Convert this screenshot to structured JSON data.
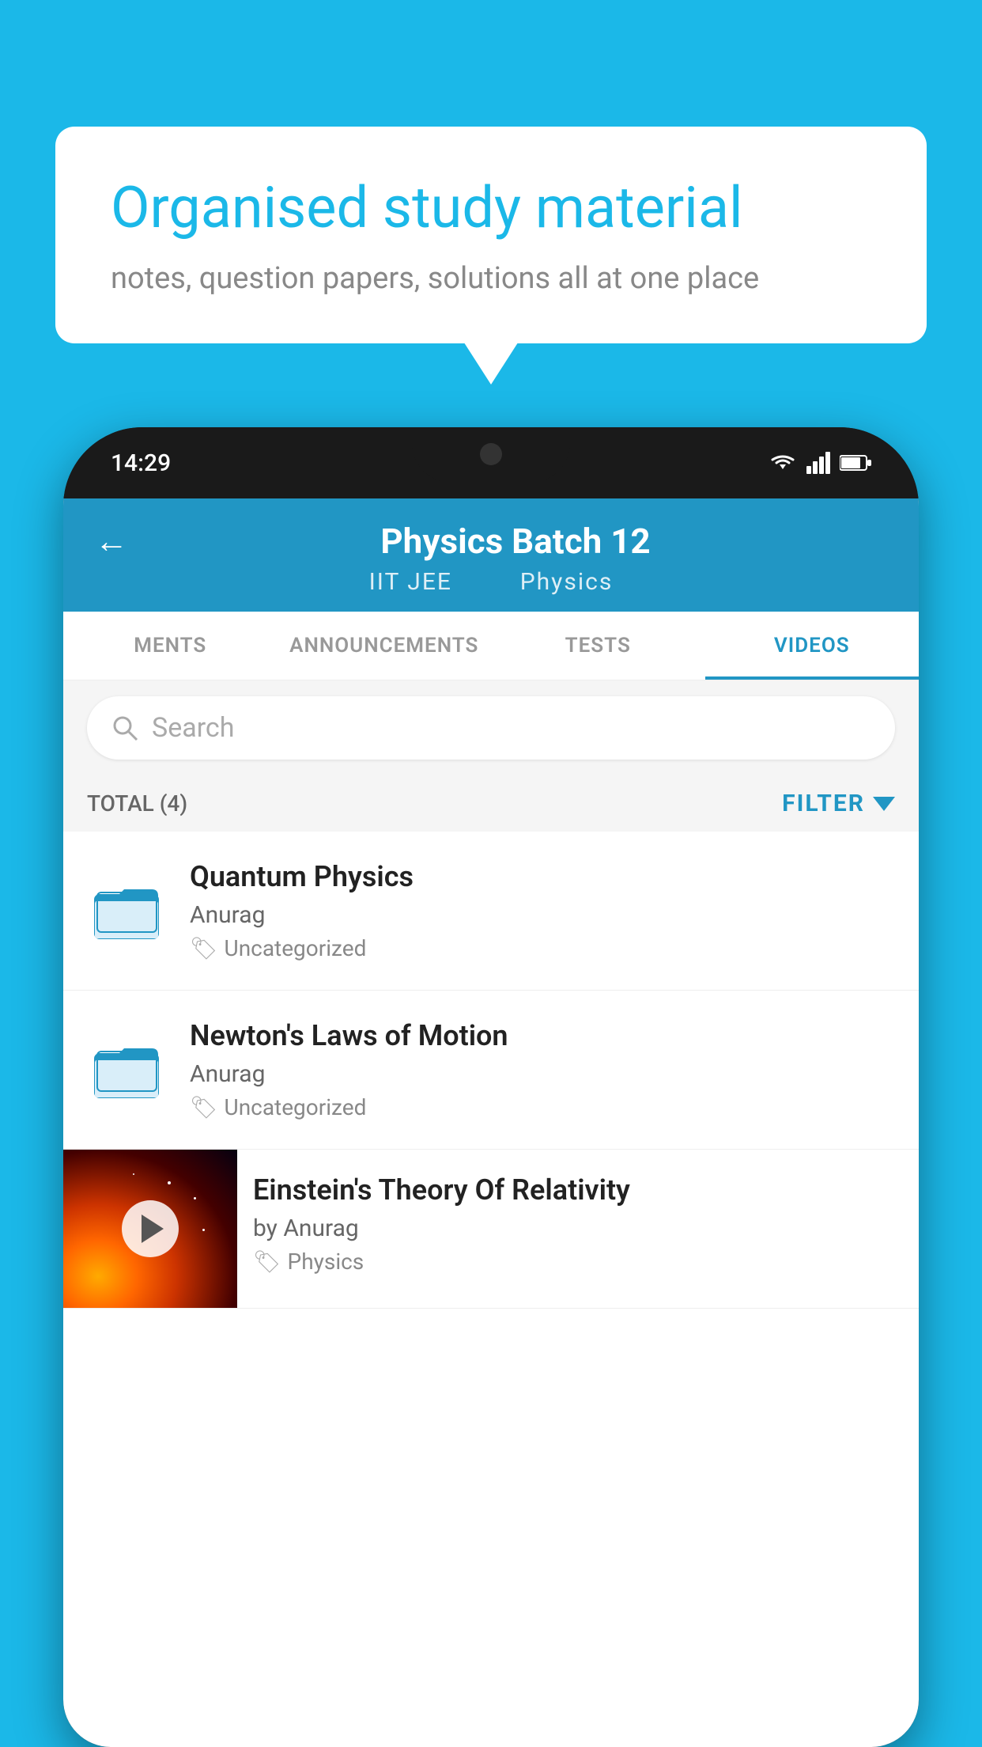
{
  "background_color": "#1bb8e8",
  "speech_bubble": {
    "title": "Organised study material",
    "subtitle": "notes, question papers, solutions all at one place"
  },
  "status_bar": {
    "time": "14:29",
    "icons": [
      "wifi",
      "signal",
      "battery"
    ]
  },
  "app_header": {
    "back_label": "←",
    "title": "Physics Batch 12",
    "subtitle_part1": "IIT JEE",
    "subtitle_part2": "Physics"
  },
  "tabs": [
    {
      "label": "MENTS",
      "active": false
    },
    {
      "label": "ANNOUNCEMENTS",
      "active": false
    },
    {
      "label": "TESTS",
      "active": false
    },
    {
      "label": "VIDEOS",
      "active": true
    }
  ],
  "search": {
    "placeholder": "Search"
  },
  "filter_row": {
    "total_label": "TOTAL (4)",
    "filter_label": "FILTER"
  },
  "videos": [
    {
      "id": 1,
      "title": "Quantum Physics",
      "author": "Anurag",
      "tag": "Uncategorized",
      "has_thumbnail": false
    },
    {
      "id": 2,
      "title": "Newton's Laws of Motion",
      "author": "Anurag",
      "tag": "Uncategorized",
      "has_thumbnail": false
    },
    {
      "id": 3,
      "title": "Einstein's Theory Of Relativity",
      "author": "by Anurag",
      "tag": "Physics",
      "has_thumbnail": true
    }
  ]
}
